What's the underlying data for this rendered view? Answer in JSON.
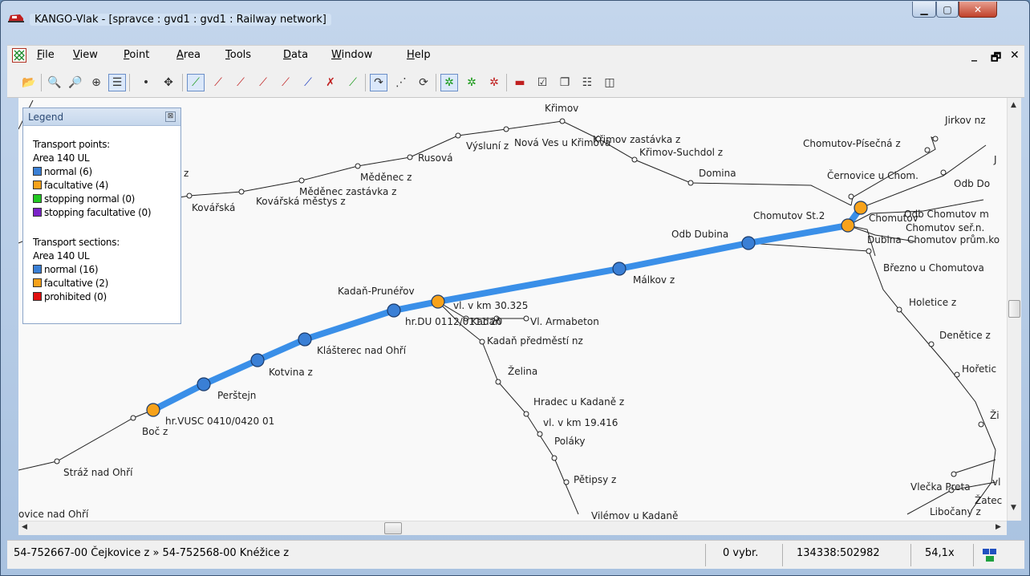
{
  "window": {
    "title": "KANGO-Vlak - [spravce : gvd1 : gvd1 : Railway network]"
  },
  "menu": {
    "items": [
      "File",
      "View",
      "Point",
      "Area",
      "Tools",
      "Data",
      "Window",
      "Help"
    ]
  },
  "toolbar": {
    "buttons": [
      "open-icon",
      "zoom-in-icon",
      "zoom-out-icon",
      "zoom-fit-icon",
      "list-view-icon",
      "point-add-icon",
      "point-move-icon",
      "section-icon",
      "section-query-icon",
      "section-z-icon",
      "section-zq-icon",
      "section-draw-icon",
      "section-edit-icon",
      "section-delete-icon",
      "section-select-icon",
      "route-icon",
      "route-dots-icon",
      "route-refresh-icon",
      "network-icon",
      "network-edit-icon",
      "network-delete-icon",
      "train-icon",
      "checklist-icon",
      "windows-cascade-icon",
      "windows-horizontal-icon",
      "windows-vertical-icon"
    ]
  },
  "legend": {
    "title": "Legend",
    "points_heading": "Transport points:",
    "points_area": "Area 140 UL",
    "points": [
      {
        "label": "normal (6)",
        "color": "#3a7fd5"
      },
      {
        "label": "facultative (4)",
        "color": "#f7a21b"
      },
      {
        "label": "stopping normal (0)",
        "color": "#22c822"
      },
      {
        "label": "stopping facultative (0)",
        "color": "#7b22c8"
      }
    ],
    "sections_heading": "Transport sections:",
    "sections_area": "Area 140 UL",
    "sections": [
      {
        "label": "normal (16)",
        "color": "#3a7fd5"
      },
      {
        "label": "facultative (2)",
        "color": "#f7a21b"
      },
      {
        "label": "prohibited (0)",
        "color": "#e01010"
      }
    ]
  },
  "map": {
    "colors": {
      "normal": "#3a7fd5",
      "facultative": "#f7a21b",
      "track": "#222222",
      "highlight": "#3a8fe8"
    },
    "labels": [
      "Křimov",
      "Křimov zastávka z",
      "Nová Ves u Křimova",
      "Výsluní z",
      "Křimov-Suchdol z",
      "Rusová",
      "Domina",
      "Měděnec z",
      "Měděnec zastávka z",
      "Kovářská městys z",
      "Kovářská",
      "z",
      "Jirkov nz",
      "Chomutov-Písečná z",
      "Černovice u Chom.",
      "Odb Do",
      "J",
      "Chomutov St.2",
      "Chomutov",
      "Odb Chomutov m",
      "Chomutov seř.n.",
      "Odb Dubina",
      "Dubina",
      "Chomutov prům.ko",
      "Březno u Chomutova",
      "Málkov z",
      "Kadaň-Prunéřov",
      "vl. v km 30.325",
      "hr.DU 0112/0111 20",
      "Kadaň",
      "Vl. Armabeton",
      "Kadaň předměstí nz",
      "Klášterec nad Ohří",
      "Želina",
      "Hradec u Kadaně z",
      "vl. v km 19.416",
      "Poláky",
      "Pětipsy z",
      "Vilémov u Kadaně",
      "Kotvina z",
      "Perštejn",
      "hr.VUSC 0410/0420 01",
      "Boč z",
      "Stráž nad Ohří",
      "ovice nad Ohří",
      "Holetice z",
      "Denětice z",
      "Hořetic",
      "Ži",
      "Vlečka Preta",
      "vl",
      "Žatec",
      "Libočany z"
    ]
  },
  "statusbar": {
    "section": "54-752667-00 Čejkovice z » 54-752568-00 Knéžice z",
    "selected": "0 vybr.",
    "coords": "134338:502982",
    "zoom": "54,1x"
  }
}
